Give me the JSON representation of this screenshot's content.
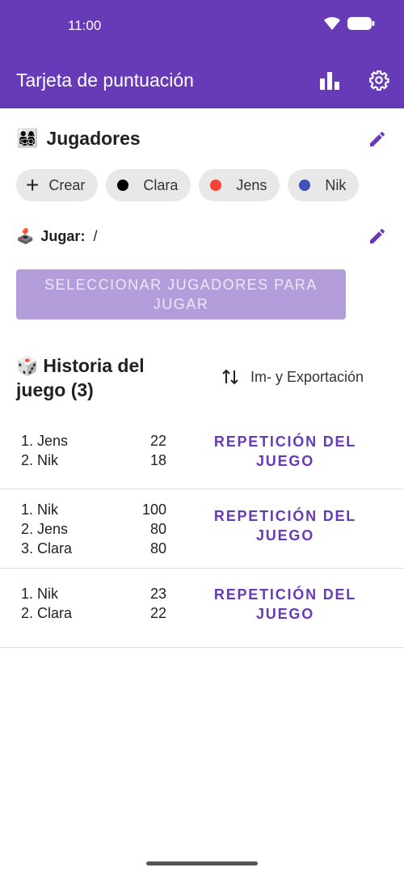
{
  "status_bar": {
    "time": "11:00"
  },
  "app_bar": {
    "title": "Tarjeta de puntuación",
    "actions": [
      "statistics-icon",
      "settings-icon"
    ]
  },
  "players": {
    "emoji": "👨‍👩‍👧‍👦",
    "title": "Jugadores",
    "chips": [
      {
        "label": "Crear",
        "icon": "plus-icon"
      },
      {
        "label": "Clara",
        "color": "#000000"
      },
      {
        "label": "Jens",
        "color": "#f44336"
      },
      {
        "label": "Nik",
        "color": "#3f51b5"
      }
    ]
  },
  "play": {
    "emoji": "🕹️",
    "label": "Jugar:",
    "value": "/"
  },
  "select_button": {
    "label": "SELECCIONAR JUGADORES PARA JUGAR"
  },
  "history": {
    "emoji": "🎲",
    "title": "Historia del juego (3)",
    "export_label": "Im- y Exportación",
    "games": [
      {
        "ranking": [
          {
            "place": "1. Jens",
            "score": "22"
          },
          {
            "place": "2. Nik",
            "score": "18"
          }
        ],
        "replay_label": "REPETICIÓN DEL JUEGO"
      },
      {
        "ranking": [
          {
            "place": "1. Nik",
            "score": "100"
          },
          {
            "place": "2. Jens",
            "score": "80"
          },
          {
            "place": "3. Clara",
            "score": "80"
          }
        ],
        "replay_label": "REPETICIÓN DEL JUEGO"
      },
      {
        "ranking": [
          {
            "place": "1. Nik",
            "score": "23"
          },
          {
            "place": "2. Clara",
            "score": "22"
          }
        ],
        "replay_label": "REPETICIÓN DEL JUEGO"
      }
    ]
  },
  "colors": {
    "primary": "#673ab7",
    "primary_disabled": "#b39ddb"
  }
}
